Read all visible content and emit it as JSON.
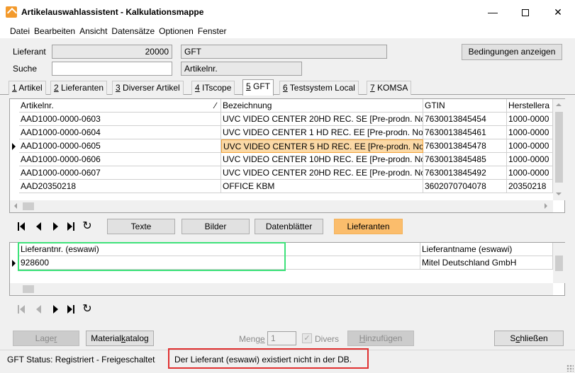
{
  "window": {
    "title": "Artikelauswahlassistent - Kalkulationsmappe",
    "controls": {
      "minimize": "—",
      "maximize": "",
      "close": "✕"
    }
  },
  "menu": [
    "Datei",
    "Bearbeiten",
    "Ansicht",
    "Datensätze",
    "Optionen",
    "Fenster"
  ],
  "header": {
    "lieferant_label": "Lieferant",
    "lieferant_number": "20000",
    "lieferant_name": "GFT",
    "suche_label": "Suche",
    "suche_value": "",
    "suche_field_name": "Artikelnr.",
    "conditions_button": "Bedingungen anzeigen"
  },
  "tabs": [
    {
      "num": "1",
      "label": " Artikel"
    },
    {
      "num": "2",
      "label": " Lieferanten"
    },
    {
      "num": "3",
      "label": " Diverser Artikel"
    },
    {
      "num": "4",
      "label": " ITscope"
    },
    {
      "num": "5",
      "label": " GFT",
      "active": true
    },
    {
      "num": "6",
      "label": " Testsystem Local"
    },
    {
      "num": "7",
      "label": " KOMSA"
    }
  ],
  "articles_grid": {
    "columns": [
      "Artikelnr.",
      "Bezeichnung",
      "GTIN",
      "Herstellera"
    ],
    "sort_indicator": "∕",
    "rows": [
      [
        "AAD1000-0000-0603",
        "UVC VIDEO CENTER 20HD REC. SE [Pre-prodn. No",
        "7630013845454",
        "1000-0000"
      ],
      [
        "AAD1000-0000-0604",
        "UVC VIDEO CENTER 1 HD REC. EE [Pre-prodn. No",
        "7630013845461",
        "1000-0000"
      ],
      [
        "AAD1000-0000-0605",
        "UVC VIDEO CENTER 5 HD REC. EE [Pre-prodn. No",
        "7630013845478",
        "1000-0000"
      ],
      [
        "AAD1000-0000-0606",
        "UVC VIDEO CENTER 10HD REC. EE [Pre-prodn. No",
        "7630013845485",
        "1000-0000"
      ],
      [
        "AAD1000-0000-0607",
        "UVC VIDEO CENTER 20HD REC. EE [Pre-prodn. No",
        "7630013845492",
        "1000-0000"
      ],
      [
        "AAD20350218",
        "OFFICE KBM",
        "3602070704078",
        "20350218"
      ]
    ],
    "current_row": 2
  },
  "detail_buttons": {
    "texte": "Texte",
    "bilder": "Bilder",
    "datenblaetter": "Datenblätter",
    "lieferanten": "Lieferanten"
  },
  "supplier_grid": {
    "columns": [
      "Lieferantnr. (eswawi)",
      "Lieferantname (eswawi)"
    ],
    "rows": [
      [
        "928600",
        "Mitel Deutschland GmbH"
      ]
    ]
  },
  "bottom": {
    "lager_prefix": "Lage",
    "lager_underlined": "r",
    "material_prefix": "Material",
    "material_underlined": "k",
    "material_suffix": "atalog",
    "menge_prefix": "Meng",
    "menge_underlined": "e",
    "menge_value": "1",
    "divers_label": "Divers",
    "divers_check": "✓",
    "hinzu_underlined": "H",
    "hinzu_suffix": "inzufügen",
    "schliessen_prefix": "S",
    "schliessen_underlined": "c",
    "schliessen_suffix": "hließen"
  },
  "status": {
    "left": "GFT Status: Registriert - Freigeschaltet",
    "message": "Der Lieferant (eswawi) existiert nicht in der DB."
  }
}
